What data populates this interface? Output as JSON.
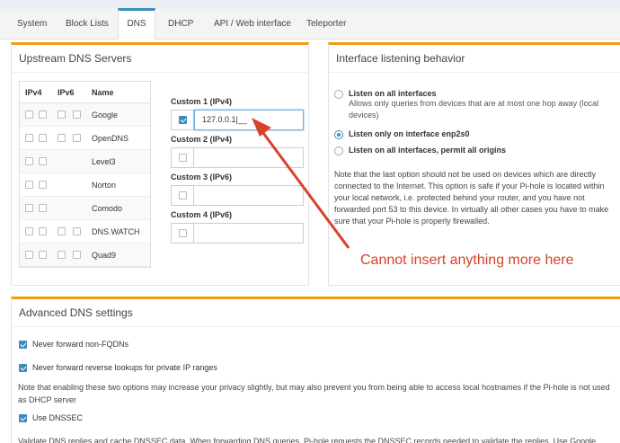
{
  "tabs": [
    "System",
    "Block Lists",
    "DNS",
    "DHCP",
    "API / Web interface",
    "Teleporter"
  ],
  "upstream": {
    "title": "Upstream DNS Servers",
    "headers": [
      "IPv4",
      "IPv6",
      "Name"
    ],
    "servers": [
      {
        "name": "Google",
        "ipv6": true
      },
      {
        "name": "OpenDNS",
        "ipv6": true
      },
      {
        "name": "Level3",
        "ipv6": false
      },
      {
        "name": "Norton",
        "ipv6": false
      },
      {
        "name": "Comodo",
        "ipv6": false
      },
      {
        "name": "DNS.WATCH",
        "ipv6": true
      },
      {
        "name": "Quad9",
        "ipv6": true
      }
    ],
    "custom": [
      {
        "label": "Custom 1 (IPv4)",
        "value": "127.0.0.1|__",
        "checked": true
      },
      {
        "label": "Custom 2 (IPv4)",
        "value": "",
        "checked": false
      },
      {
        "label": "Custom 3 (IPv6)",
        "value": "",
        "checked": false
      },
      {
        "label": "Custom 4 (IPv6)",
        "value": "",
        "checked": false
      }
    ]
  },
  "interface": {
    "title": "Interface listening behavior",
    "options": [
      {
        "label": "Listen on all interfaces",
        "desc": "Allows only queries from devices that are at most one hop away (local devices)",
        "selected": false
      },
      {
        "label": "Listen only on interface enp2s0",
        "desc": "",
        "selected": true
      },
      {
        "label": "Listen on all interfaces, permit all origins",
        "desc": "",
        "selected": false
      }
    ],
    "note": "Note that the last option should not be used on devices which are directly connected to the Internet. This option is safe if your Pi-hole is located within your local network, i.e. protected behind your router, and you have not forwarded port 53 to this device. In virtually all other cases you have to make sure that your Pi-hole is properly firewalled."
  },
  "annotation": "Cannot insert anything more here",
  "advanced": {
    "title": "Advanced DNS settings",
    "opt1": "Never forward non-FQDNs",
    "opt2": "Never forward reverse lookups for private IP ranges",
    "note": "Note that enabling these two options may increase your privacy slightly, but may also prevent you from being able to access local hostnames if the Pi-hole is not used as DHCP server",
    "opt3": "Use DNSSEC",
    "footer": "Validate DNS replies and cache DNSSEC data. When forwarding DNS queries, Pi-hole requests the DNSSEC records needed to validate the replies. Use Google"
  },
  "colors": {
    "accent": "#3c8dbc",
    "box_top": "#f39c12",
    "annotation": "#d9412a"
  }
}
